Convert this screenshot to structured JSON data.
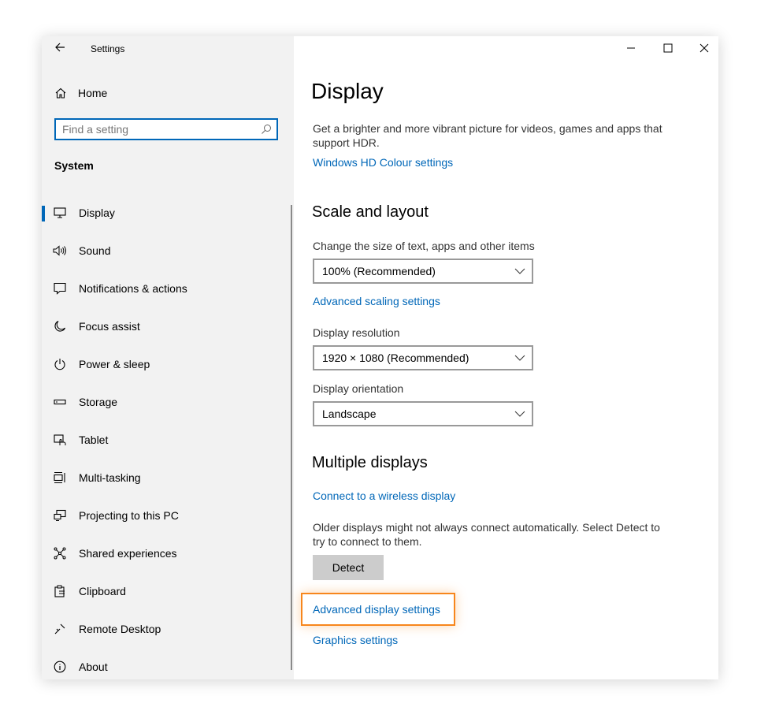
{
  "titlebar": {
    "title": "Settings"
  },
  "sidebar": {
    "home_label": "Home",
    "search_placeholder": "Find a setting",
    "section": "System",
    "items": [
      {
        "label": "Display",
        "icon": "monitor-icon",
        "active": true
      },
      {
        "label": "Sound",
        "icon": "speaker-icon"
      },
      {
        "label": "Notifications & actions",
        "icon": "notification-icon"
      },
      {
        "label": "Focus assist",
        "icon": "moon-icon"
      },
      {
        "label": "Power & sleep",
        "icon": "power-icon"
      },
      {
        "label": "Storage",
        "icon": "storage-icon"
      },
      {
        "label": "Tablet",
        "icon": "tablet-icon"
      },
      {
        "label": "Multi-tasking",
        "icon": "multitasking-icon"
      },
      {
        "label": "Projecting to this PC",
        "icon": "projecting-icon"
      },
      {
        "label": "Shared experiences",
        "icon": "shared-icon"
      },
      {
        "label": "Clipboard",
        "icon": "clipboard-icon"
      },
      {
        "label": "Remote Desktop",
        "icon": "remote-desktop-icon"
      },
      {
        "label": "About",
        "icon": "info-icon"
      }
    ]
  },
  "main": {
    "title": "Display",
    "hdr_text": "Get a brighter and more vibrant picture for videos, games and apps that support HDR.",
    "hdr_link": "Windows HD Colour settings",
    "scale_heading": "Scale and layout",
    "scale_label": "Change the size of text, apps and other items",
    "scale_value": "100% (Recommended)",
    "advanced_scaling_link": "Advanced scaling settings",
    "resolution_label": "Display resolution",
    "resolution_value": "1920 × 1080 (Recommended)",
    "orientation_label": "Display orientation",
    "orientation_value": "Landscape",
    "multiple_heading": "Multiple displays",
    "wireless_link": "Connect to a wireless display",
    "detect_text": "Older displays might not always connect automatically. Select Detect to try to connect to them.",
    "detect_button": "Detect",
    "advanced_display_link": "Advanced display settings",
    "graphics_link": "Graphics settings"
  },
  "colors": {
    "accent": "#0067b8",
    "highlight": "#f7861c",
    "sidebar_bg": "#f2f2f2"
  }
}
